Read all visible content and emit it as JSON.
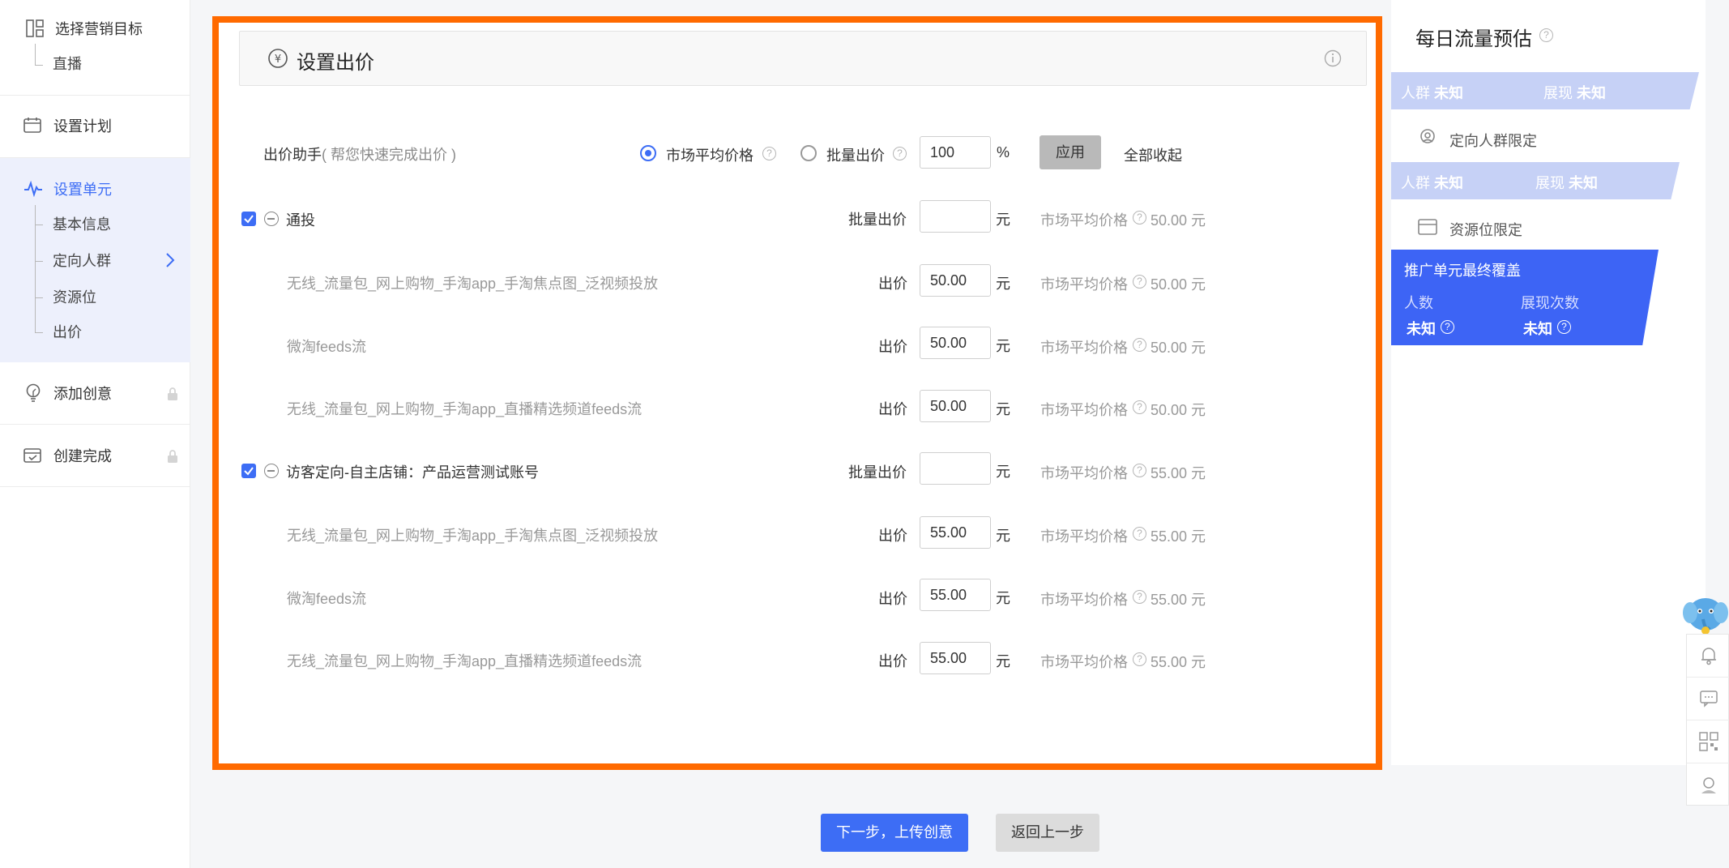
{
  "sidebar": {
    "target": {
      "label": "选择营销目标",
      "sub": "直播"
    },
    "plan": {
      "label": "设置计划"
    },
    "unit": {
      "label": "设置单元",
      "subs": [
        "基本信息",
        "定向人群",
        "资源位",
        "出价"
      ]
    },
    "creative": {
      "label": "添加创意"
    },
    "done": {
      "label": "创建完成"
    }
  },
  "panel": {
    "title": "设置出价",
    "assistant_label": "出价助手",
    "assistant_hint": "( 帮您快速完成出价 )",
    "radio_market": "市场平均价格",
    "radio_batch": "批量出价",
    "percent_value": "100",
    "percent_sign": "%",
    "apply_button": "应用",
    "collapse_all": "全部收起",
    "batch_label": "批量出价",
    "bid_label": "出价",
    "yuan": "元",
    "market_label": "市场平均价格",
    "groups": [
      {
        "name": "通投",
        "market_price": "50.00 元",
        "rows": [
          {
            "name": "无线_流量包_网上购物_手淘app_手淘焦点图_泛视频投放",
            "bid": "50.00",
            "market_price": "50.00 元"
          },
          {
            "name": "微淘feeds流",
            "bid": "50.00",
            "market_price": "50.00 元"
          },
          {
            "name": "无线_流量包_网上购物_手淘app_直播精选频道feeds流",
            "bid": "50.00",
            "market_price": "50.00 元"
          }
        ]
      },
      {
        "name": "访客定向-自主店铺：产品运营测试账号",
        "market_price": "55.00 元",
        "rows": [
          {
            "name": "无线_流量包_网上购物_手淘app_手淘焦点图_泛视频投放",
            "bid": "55.00",
            "market_price": "55.00 元"
          },
          {
            "name": "微淘feeds流",
            "bid": "55.00",
            "market_price": "55.00 元"
          },
          {
            "name": "无线_流量包_网上购物_手淘app_直播精选频道feeds流",
            "bid": "55.00",
            "market_price": "55.00 元"
          }
        ]
      }
    ]
  },
  "footer": {
    "next": "下一步，上传创意",
    "back": "返回上一步"
  },
  "right": {
    "title": "每日流量预估",
    "band_people": "人群",
    "band_show": "展现",
    "unknown": "未知",
    "audience_limit": "定向人群限定",
    "resource_limit": "资源位限定",
    "final_title": "推广单元最终覆盖",
    "final_people": "人数",
    "final_views": "展现次数"
  },
  "colors": {
    "accent": "#3d6df5",
    "highlight_border": "#ff6a00"
  }
}
